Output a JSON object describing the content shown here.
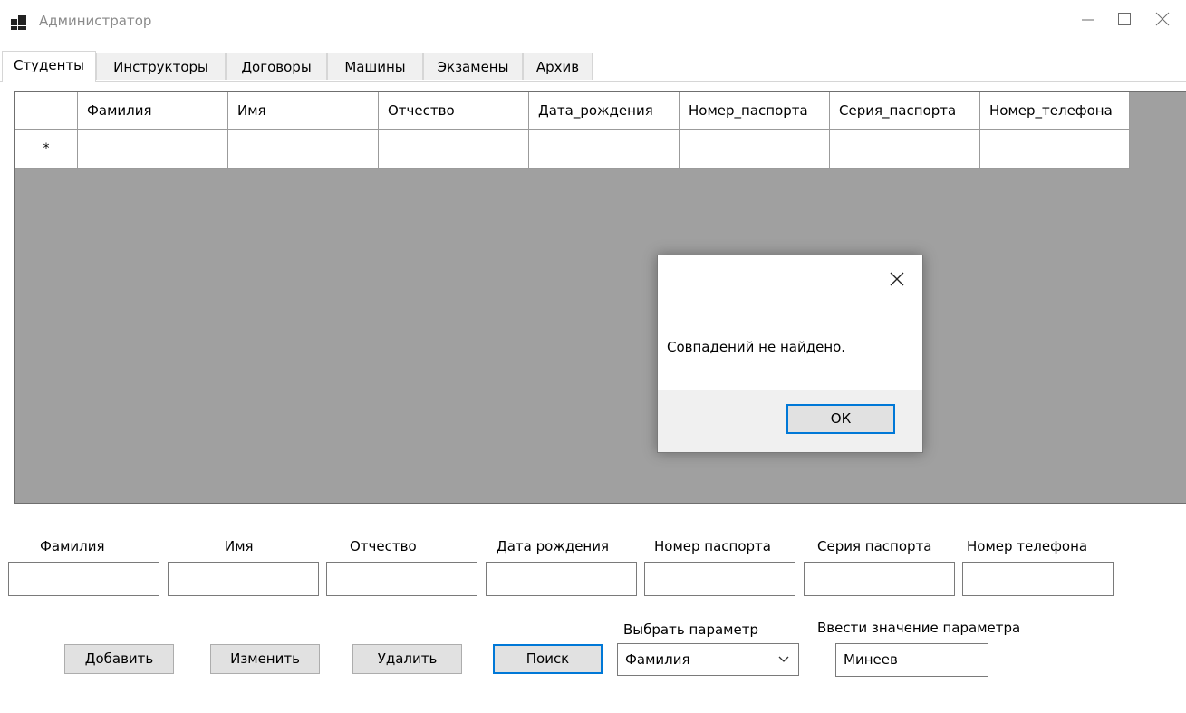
{
  "window": {
    "title": "Администратор",
    "controls": [
      "minimize",
      "maximize",
      "close"
    ]
  },
  "tabs": [
    {
      "label": "Студенты",
      "active": true
    },
    {
      "label": "Инструкторы",
      "active": false
    },
    {
      "label": "Договоры",
      "active": false
    },
    {
      "label": "Машины",
      "active": false
    },
    {
      "label": "Экзамены",
      "active": false
    },
    {
      "label": "Архив",
      "active": false
    }
  ],
  "grid": {
    "columns": [
      "Фамилия",
      "Имя",
      "Отчество",
      "Дата_рождения",
      "Номер_паспорта",
      "Серия_паспорта",
      "Номер_телефона"
    ],
    "new_row_marker": "*"
  },
  "dialog": {
    "message": "Совпадений не найдено.",
    "ok_label": "ОК"
  },
  "form": {
    "labels": {
      "surname": "Фамилия",
      "name": "Имя",
      "patronymic": "Отчество",
      "birth_date": "Дата рождения",
      "passport_number": "Номер паспорта",
      "passport_series": "Серия паспорта",
      "phone": "Номер телефона"
    },
    "values": {
      "surname": "",
      "name": "",
      "patronymic": "",
      "birth_date": "",
      "passport_number": "",
      "passport_series": "",
      "phone": ""
    }
  },
  "actions": {
    "add": "Добавить",
    "edit": "Изменить",
    "delete": "Удалить",
    "search": "Поиск"
  },
  "search": {
    "param_label": "Выбрать параметр",
    "param_value": "Фамилия",
    "value_label": "Ввести значение параметра",
    "value": "Минеев"
  },
  "colors": {
    "focus_accent": "#0078d7",
    "grid_background": "#a0a0a0",
    "button_face": "#e1e1e1"
  }
}
